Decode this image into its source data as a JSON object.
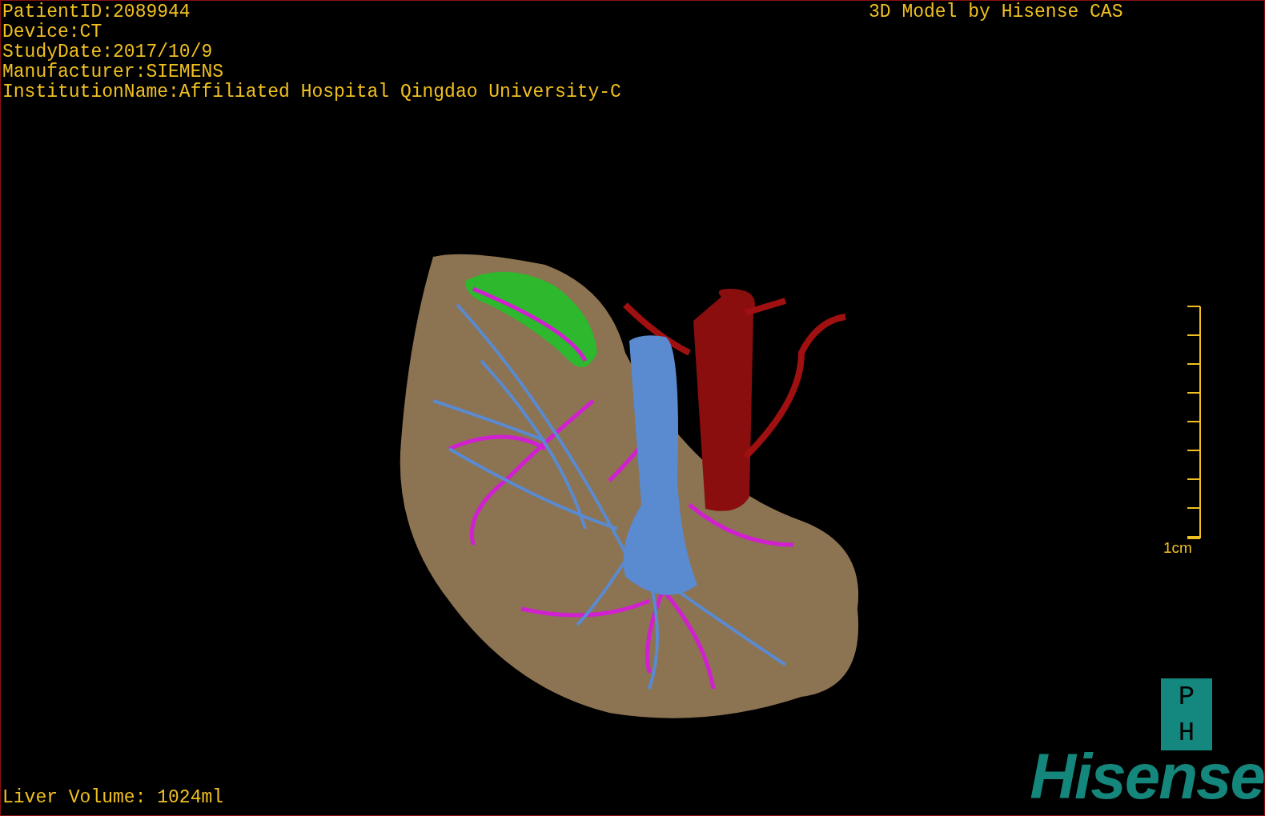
{
  "header_lines": [
    "PatientID:2089944",
    "Device:CT",
    "StudyDate:2017/10/9",
    "Manufacturer:SIEMENS",
    "InstitutionName:Affiliated Hospital Qingdao University-C"
  ],
  "model_title": "3D Model by Hisense CAS",
  "scale_bar": {
    "label": "1cm"
  },
  "orientation_marker": {
    "top": "P",
    "bottom": "H"
  },
  "logo": "Hisense",
  "liver_volume": "Liver Volume: 1024ml"
}
